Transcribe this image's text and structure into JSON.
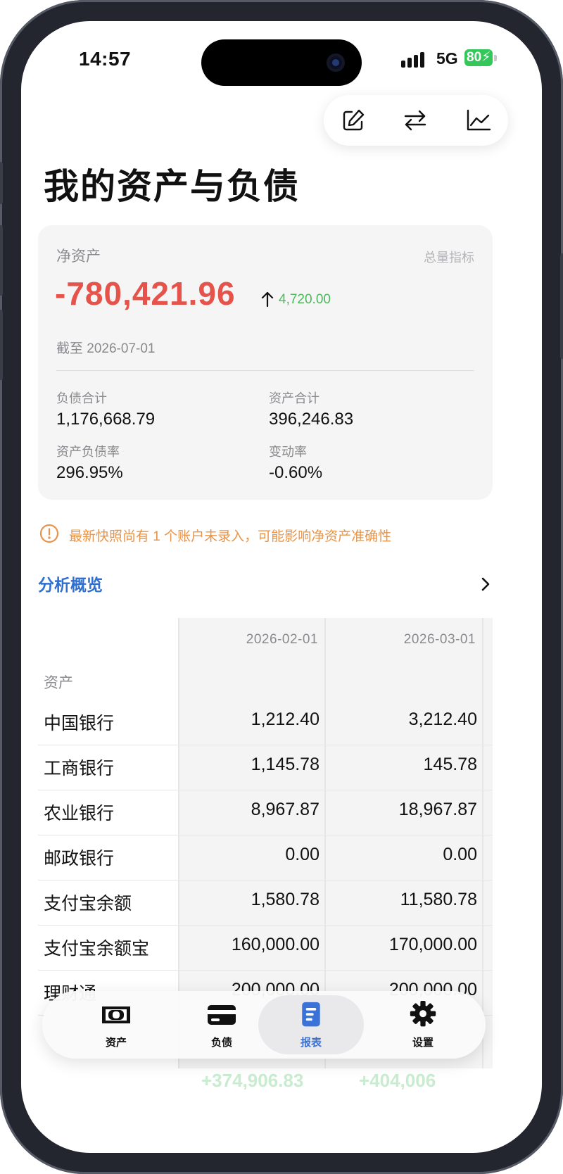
{
  "status_bar": {
    "time": "14:57",
    "network": "5G",
    "battery": "80"
  },
  "toolbar": {
    "icons": [
      "edit-icon",
      "swap-icon",
      "chart-icon"
    ]
  },
  "page": {
    "title": "我的资产与负债"
  },
  "summary": {
    "net_label": "净资产",
    "metric_link": "总量指标",
    "net_value": "-780,421.96",
    "delta": "4,720.00",
    "as_of": "截至 2026-07-01",
    "liabilities_label": "负债合计",
    "liabilities_value": "1,176,668.79",
    "assets_label": "资产合计",
    "assets_value": "396,246.83",
    "ratio_label": "资产负债率",
    "ratio_value": "296.95%",
    "change_label": "变动率",
    "change_value": "-0.60%",
    "colors": {
      "negative": "#e5534b",
      "positive": "#4cb85a"
    }
  },
  "warning": {
    "text": "最新快照尚有 1 个账户未录入，可能影响净资产准确性",
    "color": "#e8944a"
  },
  "overview": {
    "label": "分析概览"
  },
  "table": {
    "columns": [
      "2026-02-01",
      "2026-03-01"
    ],
    "section": "资产",
    "rows": [
      {
        "name": "中国银行",
        "v1": "1,212.40",
        "v2": "3,212.40"
      },
      {
        "name": "工商银行",
        "v1": "1,145.78",
        "v2": "145.78"
      },
      {
        "name": "农业银行",
        "v1": "8,967.87",
        "v2": "18,967.87"
      },
      {
        "name": "邮政银行",
        "v1": "0.00",
        "v2": "0.00"
      },
      {
        "name": "支付宝余额",
        "v1": "1,580.78",
        "v2": "11,580.78"
      },
      {
        "name": "支付宝余额宝",
        "v1": "160,000.00",
        "v2": "170,000.00"
      },
      {
        "name": "理财通",
        "v1": "200,000.00",
        "v2": "200,000.00"
      }
    ],
    "footer_partial": {
      "v1": "+374,906.83",
      "v2": "+404,006"
    }
  },
  "tabbar": {
    "tabs": [
      {
        "label": "资产",
        "icon": "cash-icon"
      },
      {
        "label": "负债",
        "icon": "credit-card-icon"
      },
      {
        "label": "报表",
        "icon": "report-icon"
      },
      {
        "label": "设置",
        "icon": "gear-icon"
      }
    ],
    "active_color": "#3a72d8"
  }
}
